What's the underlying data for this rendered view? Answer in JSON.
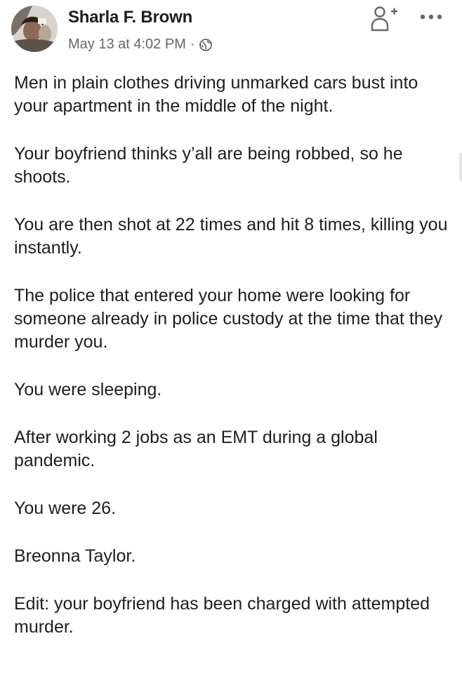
{
  "post": {
    "author": "Sharla F. Brown",
    "timestamp": "May 13 at 4:02 PM",
    "separator": "·",
    "privacy_icon": "globe-icon",
    "actions": {
      "add_friend_icon": "add-friend-icon",
      "more_icon": "more-options-icon"
    },
    "paragraphs": [
      "Men in plain clothes driving unmarked cars bust into your apartment in the middle of the night.",
      "Your boyfriend thinks y’all are being robbed, so he shoots.",
      "You are then shot at 22 times and hit 8 times, killing you instantly.",
      "The police that entered your home were looking for someone already in police custody at the time that they murder you.",
      "You were sleeping.",
      "After working 2 jobs as an EMT during a global pandemic.",
      "You were 26.",
      "Breonna Taylor.",
      "Edit: your boyfriend has been charged with attempted murder."
    ]
  },
  "colors": {
    "text_primary": "#1c1e21",
    "text_secondary": "#65676b",
    "icon": "#65676b"
  }
}
